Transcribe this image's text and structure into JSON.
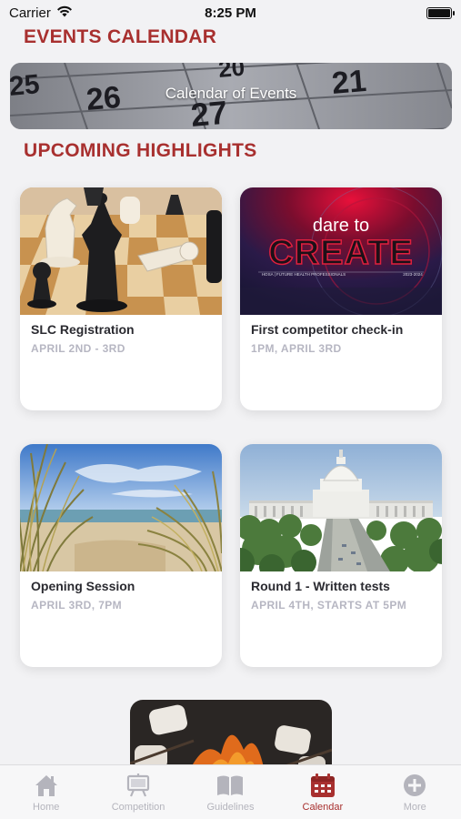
{
  "status_bar": {
    "carrier": "Carrier",
    "time": "8:25 PM"
  },
  "header": {
    "title": "EVENTS CALENDAR"
  },
  "banner": {
    "label": "Calendar of Events",
    "dates": [
      "25",
      "26",
      "27",
      "20",
      "21"
    ]
  },
  "highlights": {
    "title": "UPCOMING HIGHLIGHTS",
    "cards": [
      {
        "title": "SLC Registration",
        "subtitle": "APRIL 2ND - 3RD",
        "image": "chess-pieces"
      },
      {
        "title": "First competitor check-in",
        "subtitle": "1PM, APRIL 3RD",
        "image": "dare-to-create-logo"
      },
      {
        "title": "Opening Session",
        "subtitle": "APRIL 3RD, 7PM",
        "image": "beach-dunes"
      },
      {
        "title": "Round 1 - Written tests",
        "subtitle": "APRIL 4TH, STARTS AT 5PM",
        "image": "capitol-building"
      }
    ],
    "partial_card": {
      "image": "campfire-marshmallows"
    },
    "logo_text": {
      "line1": "dare to",
      "line2": "CREATE",
      "tagline": "HOSA | FUTURE HEALTH PROFESSIONALS",
      "years": "2023-2024"
    }
  },
  "tab_bar": {
    "active": "Calendar",
    "accent": "#a8302f",
    "inactive": "#b4b4bc",
    "tabs": [
      {
        "label": "Home",
        "icon": "home-icon"
      },
      {
        "label": "Competition",
        "icon": "easel-icon"
      },
      {
        "label": "Guidelines",
        "icon": "book-icon"
      },
      {
        "label": "Calendar",
        "icon": "calendar-icon"
      },
      {
        "label": "More",
        "icon": "plus-circle-icon"
      }
    ]
  }
}
